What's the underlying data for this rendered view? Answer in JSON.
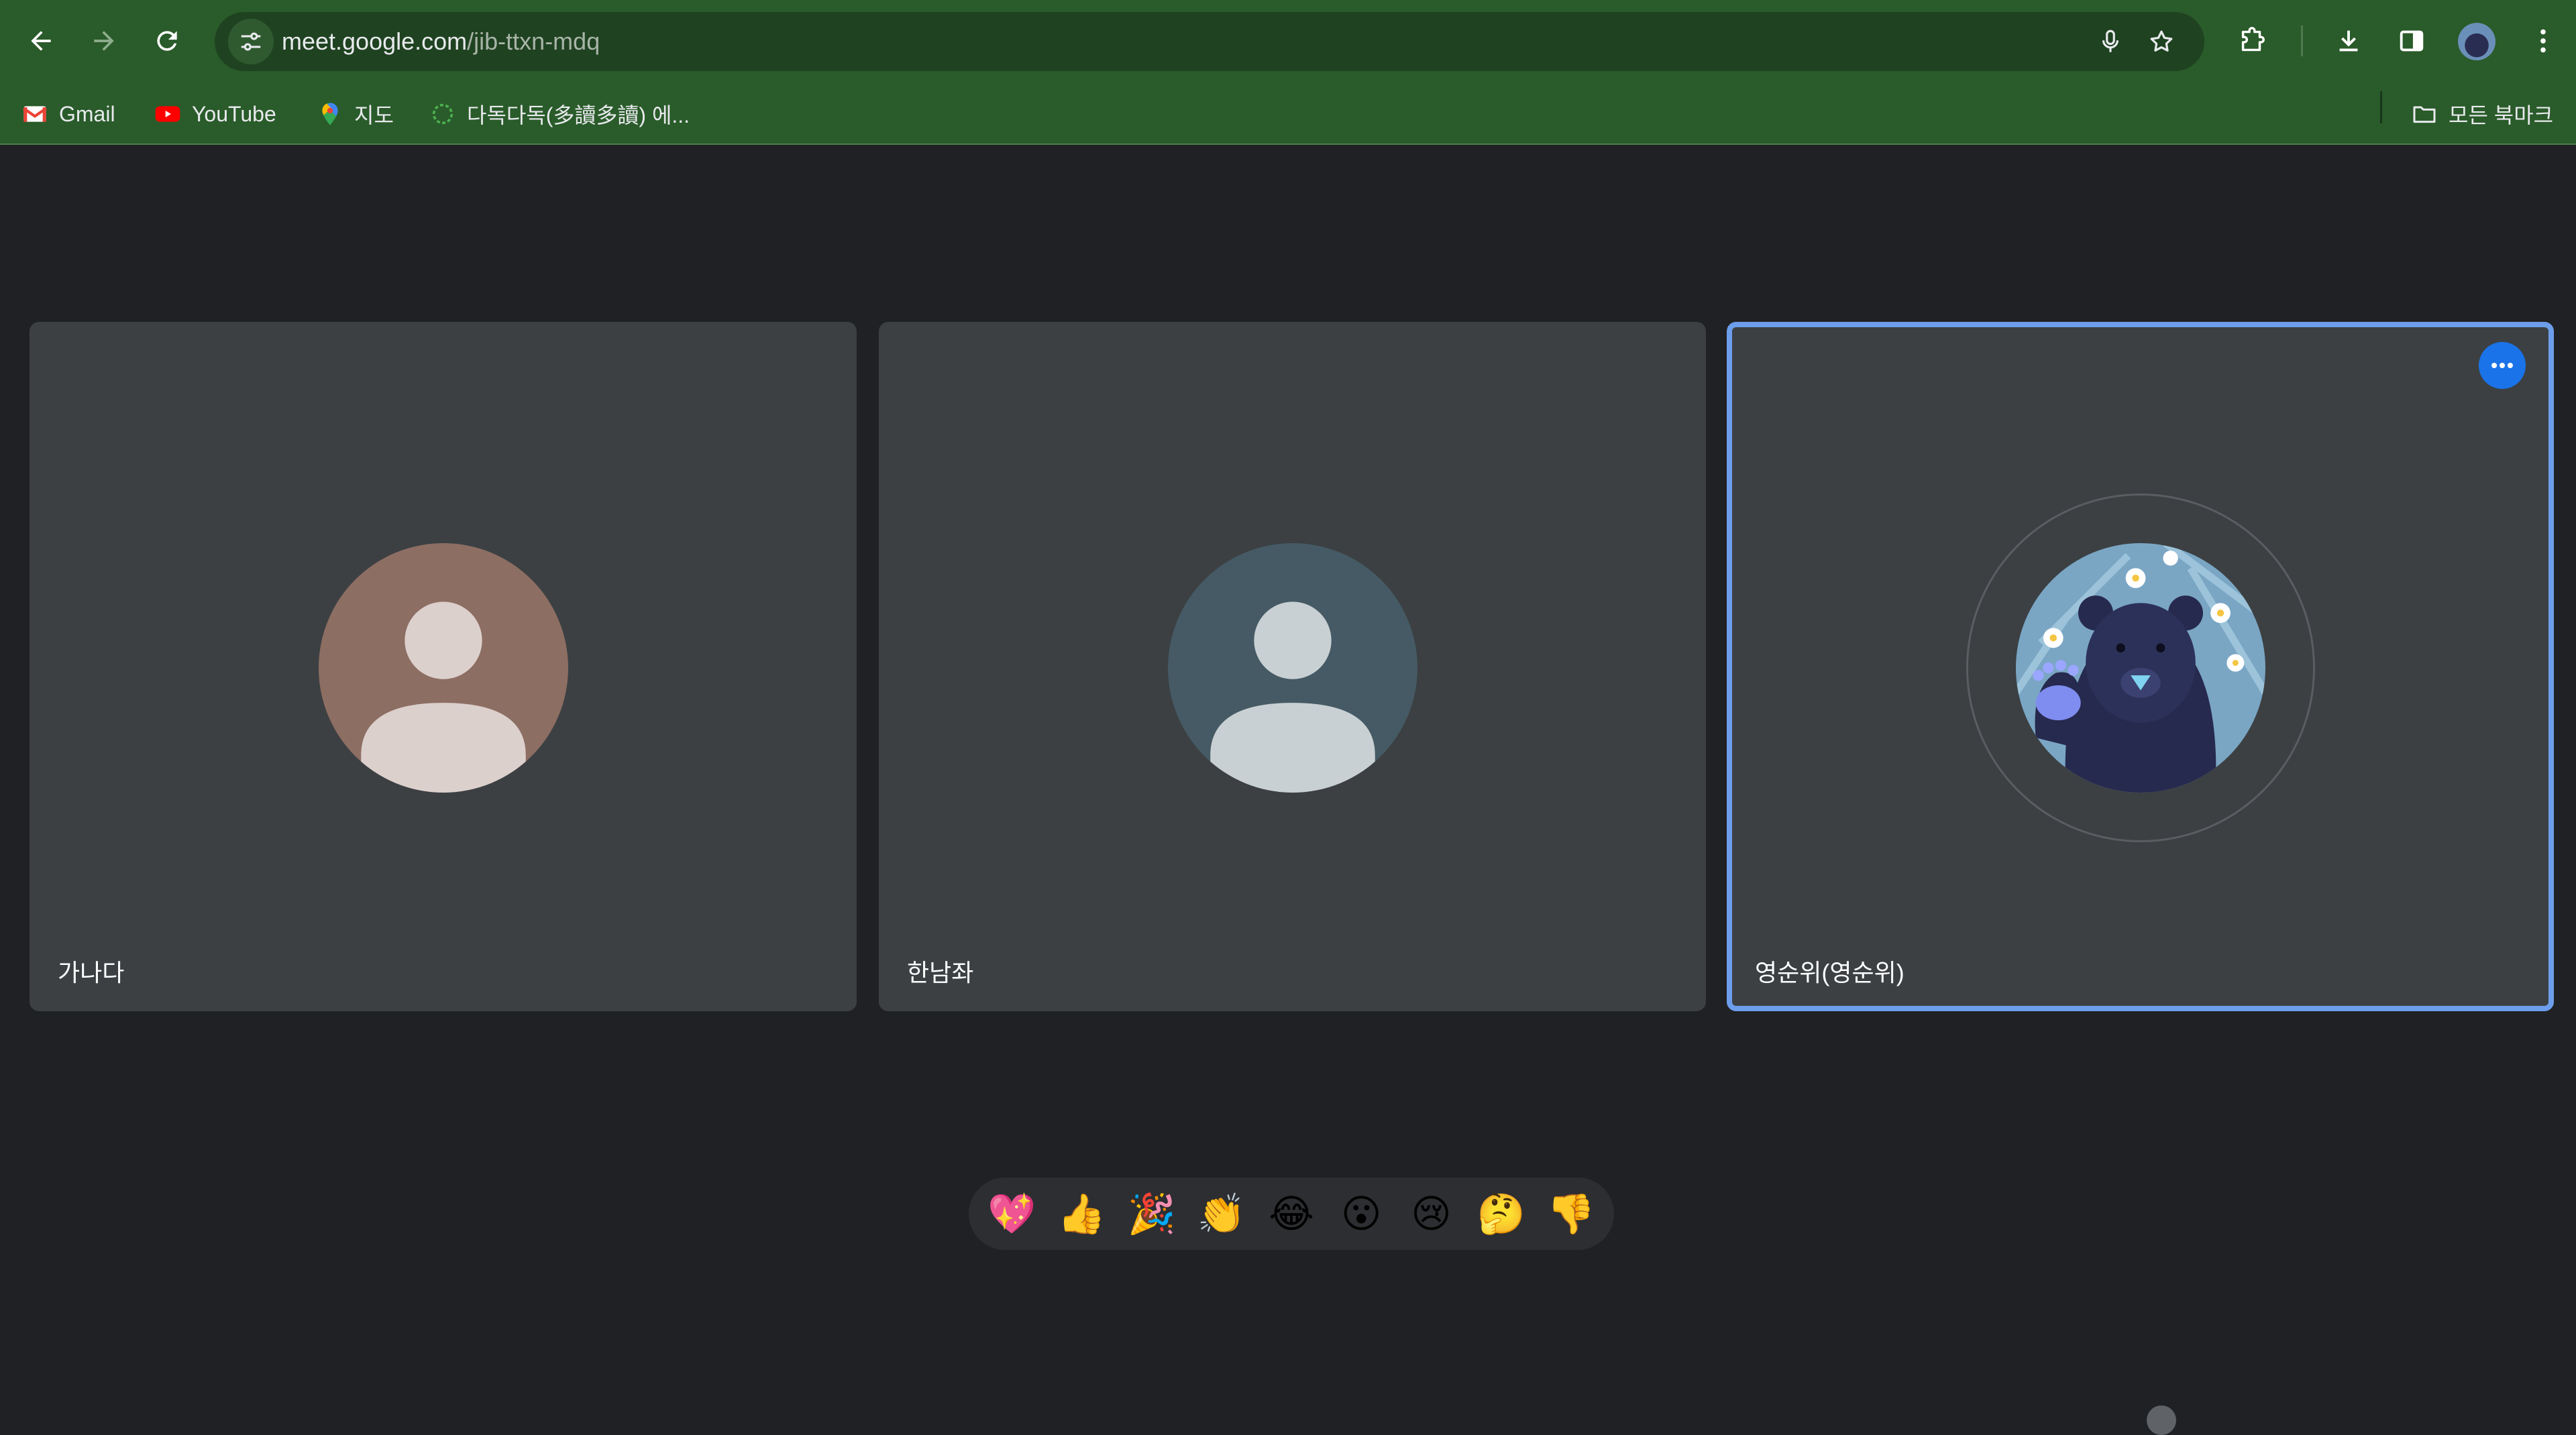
{
  "browser": {
    "url_host": "meet.google.com",
    "url_path": "/jib-ttxn-mdq",
    "bookmarks": [
      {
        "label": "Gmail",
        "icon": "gmail-icon"
      },
      {
        "label": "YouTube",
        "icon": "youtube-icon"
      },
      {
        "label": "지도",
        "icon": "maps-icon"
      },
      {
        "label": "다독다독(多讀多讀) 에...",
        "icon": "site-icon"
      }
    ],
    "all_bookmarks_label": "모든 북마크",
    "theme_color": "#2a5b2a"
  },
  "meet": {
    "participants": [
      {
        "name": "가나다",
        "avatar": "default-person-avatar",
        "color": "#8d6e63",
        "active": false
      },
      {
        "name": "한남좌",
        "avatar": "default-person-avatar",
        "color": "#455a64",
        "active": false
      },
      {
        "name": "영순위(영순위)",
        "avatar": "bear-photo-avatar",
        "color": "#6d9eeb",
        "active": true
      }
    ],
    "reactions": [
      "💖",
      "👍",
      "🎉",
      "👏",
      "😂",
      "😮",
      "😢",
      "🤔",
      "👎"
    ]
  }
}
